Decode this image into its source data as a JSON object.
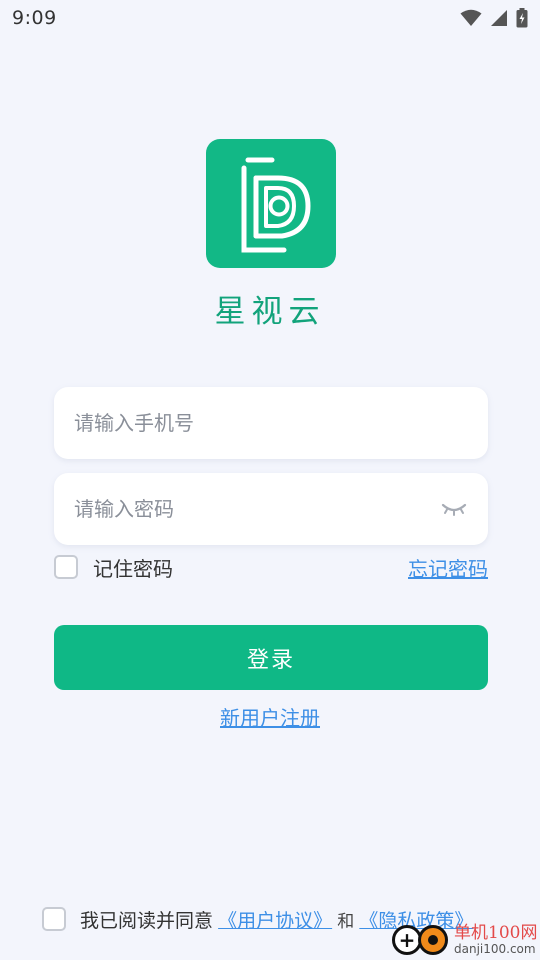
{
  "status_bar": {
    "time": "9:09",
    "icons": [
      "wifi-icon",
      "cell-signal-icon",
      "battery-charging-icon"
    ]
  },
  "app": {
    "name": "星视云",
    "logo_icon": "app-logo-d-icon",
    "brand_color": "#12b886"
  },
  "form": {
    "phone_placeholder": "请输入手机号",
    "phone_value": "",
    "password_placeholder": "请输入密码",
    "password_value": "",
    "password_toggle_icon": "eye-closed-icon",
    "remember_label": "记住密码",
    "remember_checked": false,
    "forgot_label": "忘记密码",
    "login_label": "登录",
    "register_label": "新用户注册"
  },
  "agreement": {
    "checked": false,
    "text": "我已阅读并同意",
    "user_agreement": "《用户协议》",
    "and": "和",
    "privacy_policy": "《隐私政策》"
  },
  "watermark": {
    "line1": "单机100网",
    "line2": "danji100.com"
  },
  "colors": {
    "accent": "#0fb886",
    "link": "#3d8fe6",
    "background": "#f3f5fc"
  }
}
